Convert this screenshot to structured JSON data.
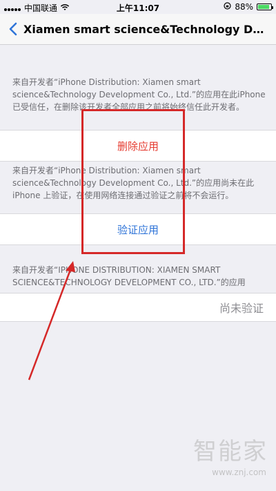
{
  "status_bar": {
    "carrier": "中国联通",
    "time": "上午11:07",
    "battery": "88%"
  },
  "nav": {
    "title": "Xiamen smart science&Technology Develop..."
  },
  "trusted_note": "来自开发者“iPhone Distribution: Xiamen smart science&Technology Development Co., Ltd.”的应用在此iPhone 已受信任，在删除该开发者全部应用之前将始终信任此开发者。",
  "delete_button": "删除应用",
  "unverified_note": "来自开发者“iPhone Distribution: Xiamen smart science&Technology Development Co., Ltd.”的应用尚未在此iPhone 上验证，在使用网络连接通过验证之前将不会运行。",
  "verify_button": "验证应用",
  "apps_header": "来自开发者“IPHONE DISTRIBUTION: XIAMEN SMART SCIENCE&TECHNOLOGY DEVELOPMENT CO., LTD.”的应用",
  "app_status": "尚未验证",
  "watermark": {
    "text": "智能家",
    "url": "www.znj.com"
  },
  "colors": {
    "danger": "#e53b30",
    "link": "#2f74d8",
    "annotation": "#d52828"
  }
}
